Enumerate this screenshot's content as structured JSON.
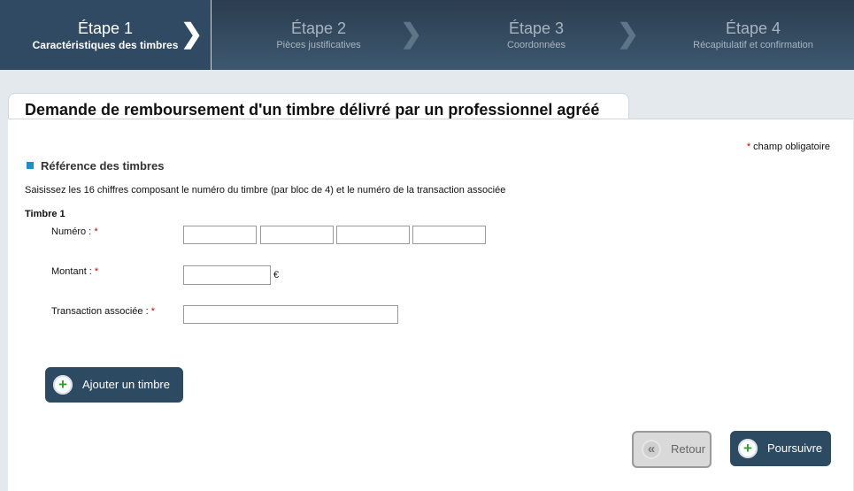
{
  "steps": [
    {
      "num": "Étape 1",
      "label": "Caractéristiques des timbres"
    },
    {
      "num": "Étape 2",
      "label": "Pièces justificatives"
    },
    {
      "num": "Étape 3",
      "label": "Coordonnées"
    },
    {
      "num": "Étape 4",
      "label": "Récapitulatif et confirmation"
    }
  ],
  "page_title": "Demande de remboursement d'un timbre délivré par un professionnel agréé",
  "required_note": {
    "star": "*",
    "text": "champ obligatoire"
  },
  "section_title": "Référence des timbres",
  "intro": "Saisissez les 16 chiffres composant le numéro du timbre (par bloc de 4) et le numéro de la transaction associée",
  "stamp": {
    "title": "Timbre 1",
    "numero_label": "Numéro :",
    "montant_label": "Montant :",
    "transaction_label": "Transaction associée :",
    "currency": "€",
    "required_star": "*",
    "numero_values": [
      "",
      "",
      "",
      ""
    ],
    "montant_value": "",
    "transaction_value": ""
  },
  "buttons": {
    "add": "Ajouter un timbre",
    "back": "Retour",
    "next": "Poursuivre"
  },
  "icons": {
    "chevron": "chevron-right-icon",
    "add": "plus-icon",
    "back": "double-chevron-left-icon",
    "next": "plus-icon"
  },
  "colors": {
    "active_step": "#2f4a62",
    "button": "#2c4a62",
    "section_marker": "#1a8fd0",
    "required": "#cc0000"
  }
}
